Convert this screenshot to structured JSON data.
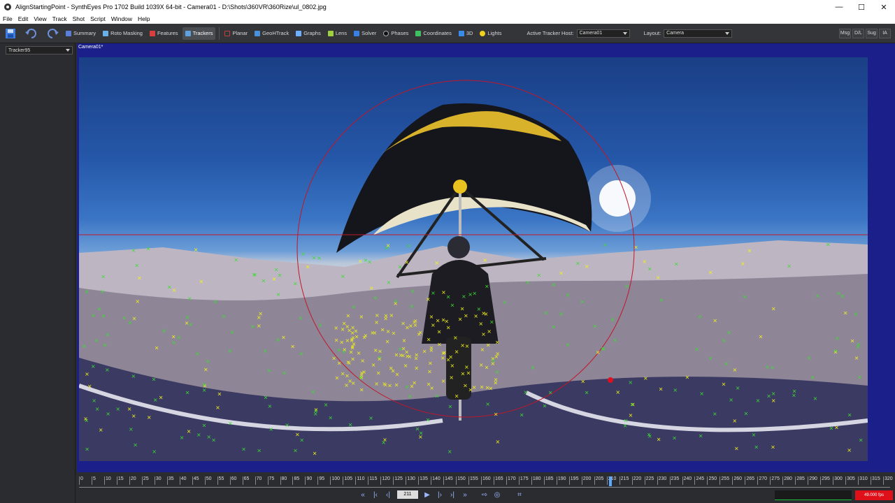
{
  "window": {
    "title": "AlignStartingPoint - SynthEyes Pro 1702 Build 1039X 64-bit - Camera01 - D:\\Shots\\360VR\\360Rize\\ul_0802.jpg",
    "minimize": "—",
    "maximize": "☐",
    "close": "✕"
  },
  "menu": [
    "File",
    "Edit",
    "View",
    "Track",
    "Shot",
    "Script",
    "Window",
    "Help"
  ],
  "toolbar": {
    "rooms": [
      "Summary",
      "Roto Masking",
      "Features",
      "Trackers",
      "Planar",
      "GeoHTrack",
      "Graphs",
      "Lens",
      "Solver",
      "Phases",
      "Coordinates",
      "3D",
      "Lights"
    ],
    "active_room": "Trackers",
    "active_tracker_host_label": "Active Tracker Host:",
    "active_tracker_host_value": "Camera01",
    "layout_label": "Layout:",
    "layout_value": "Camera",
    "right_buttons": [
      "Msg",
      "D/L",
      "Sug",
      "IA"
    ]
  },
  "left_panel": {
    "tracker_select": "Tracker95"
  },
  "viewport": {
    "tab_label": "Camera01*"
  },
  "timeline": {
    "ticks": [
      "0",
      "5",
      "10",
      "15",
      "20",
      "25",
      "30",
      "35",
      "40",
      "45",
      "50",
      "55",
      "60",
      "65",
      "70",
      "75",
      "80",
      "85",
      "90",
      "95",
      "100",
      "105",
      "110",
      "115",
      "120",
      "125",
      "130",
      "135",
      "140",
      "145",
      "150",
      "155",
      "160",
      "165",
      "170",
      "175",
      "180",
      "185",
      "190",
      "195",
      "200",
      "205",
      "210",
      "215",
      "220",
      "225",
      "230",
      "235",
      "240",
      "245",
      "250",
      "255",
      "260",
      "265",
      "270",
      "275",
      "280",
      "285",
      "290",
      "295",
      "300",
      "305",
      "310",
      "315",
      "320"
    ],
    "current_frame": "211",
    "fps_readout": "49.000 fps"
  },
  "colors": {
    "viewport_border": "#1a1f8a",
    "tracker_yellow": "#f2f21a",
    "tracker_green": "#3cdc32",
    "horizon_red": "#c0182a"
  }
}
